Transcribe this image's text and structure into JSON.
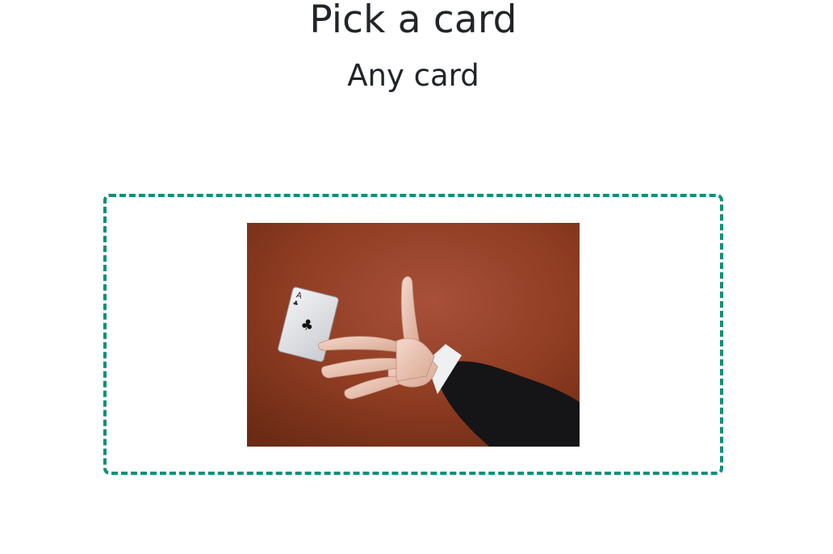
{
  "header": {
    "title": "Pick a card",
    "subtitle": "Any card"
  },
  "image": {
    "alt": "Hand tossing an ace of clubs playing card against a red-brown background"
  },
  "colors": {
    "text": "#212529",
    "dropzone_border": "#0d8f7a",
    "photo_background": "#8e3c22"
  }
}
